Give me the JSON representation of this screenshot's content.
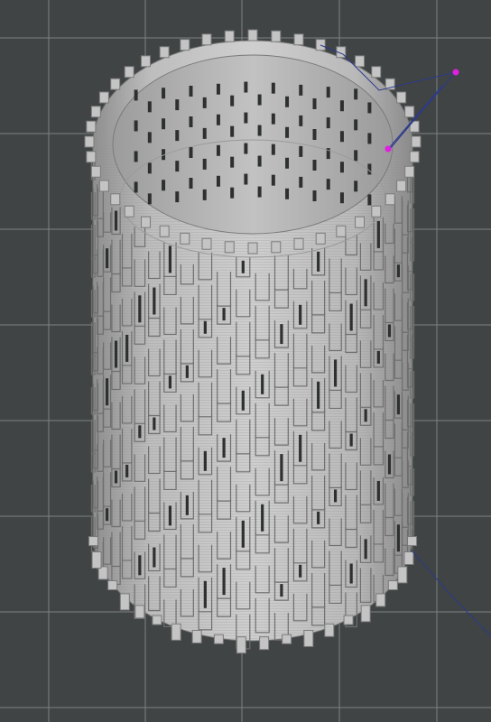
{
  "viewport": {
    "background_color": "#404444",
    "grid_line_color": "#7e8282",
    "model_color": "#c4c4c4",
    "model_shadow_color": "#6f6f6f",
    "hole_color": "#2e3030",
    "path_color": "#2b3a8c",
    "waypoint_color": "#e020e0"
  },
  "scene_objects": [
    {
      "name": "perforated-cylinder-model",
      "kind": "3d-mesh"
    },
    {
      "name": "travel-path",
      "kind": "polyline"
    },
    {
      "name": "path-waypoint",
      "kind": "control-point"
    }
  ]
}
